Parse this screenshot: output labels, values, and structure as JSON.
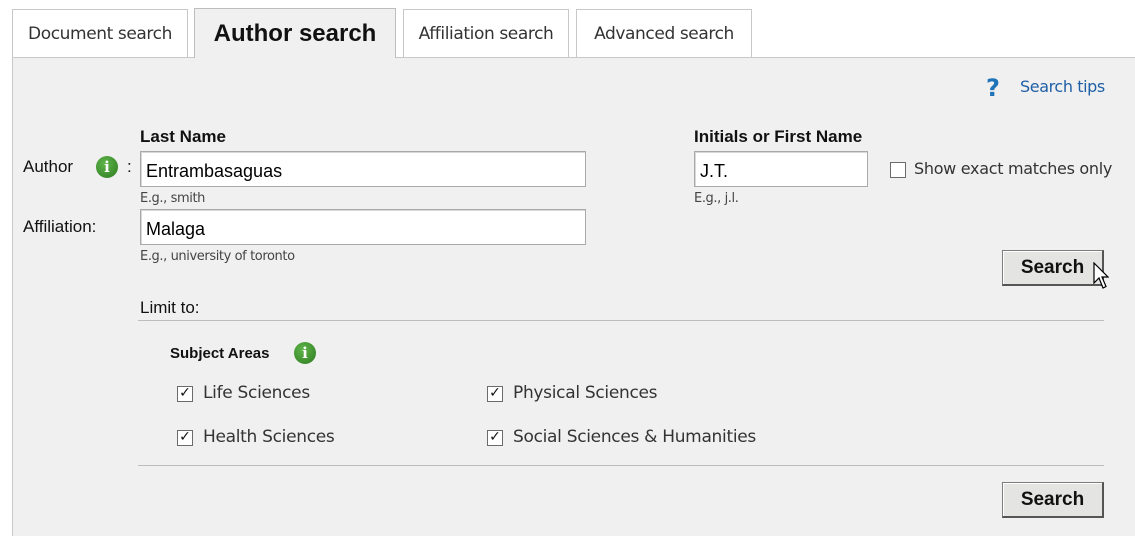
{
  "tabs": [
    {
      "label": "Document search",
      "active": false
    },
    {
      "label": "Author search",
      "active": true
    },
    {
      "label": "Affiliation search",
      "active": false
    },
    {
      "label": "Advanced search",
      "active": false
    }
  ],
  "search_tips": {
    "icon": "help-question-icon",
    "label": "Search tips"
  },
  "author": {
    "label": "Author",
    "info_icon": "info-icon",
    "colon": ":",
    "last_name_label": "Last Name",
    "last_name_value": "Entrambasaguas",
    "last_name_hint": "E.g., smith",
    "first_name_label": "Initials or First Name",
    "first_name_value": "J.T.",
    "first_name_hint": "E.g., j.l.",
    "exact_match_label": "Show exact matches only",
    "exact_match_checked": false
  },
  "affiliation": {
    "label": "Affiliation:",
    "value": "Malaga",
    "hint": "E.g., university of toronto"
  },
  "search_button_label": "Search",
  "limit": {
    "label": "Limit to:",
    "subject_areas_label": "Subject Areas",
    "subjects": [
      {
        "label": "Life Sciences",
        "checked": true
      },
      {
        "label": "Physical Sciences",
        "checked": true
      },
      {
        "label": "Health Sciences",
        "checked": true
      },
      {
        "label": "Social Sciences & Humanities",
        "checked": true
      }
    ]
  },
  "colors": {
    "panel_bg": "#f0f0f0",
    "link": "#1f5fa6",
    "info_icon": "#3d8f2b",
    "help_icon": "#1e73b9"
  }
}
